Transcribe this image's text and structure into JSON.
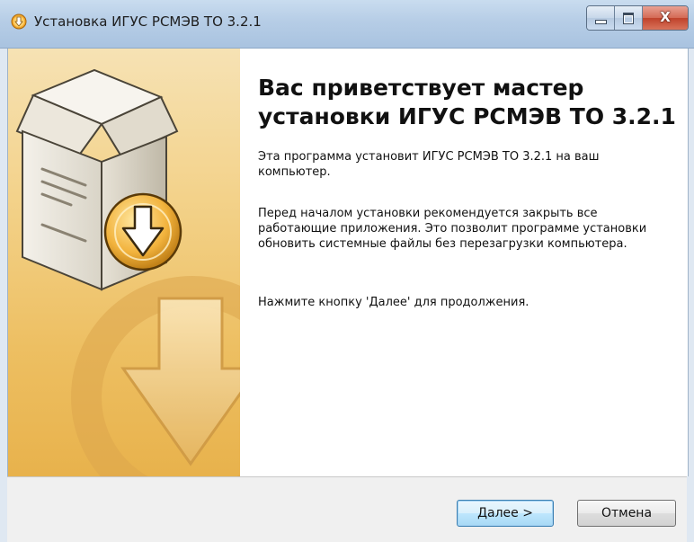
{
  "window": {
    "title": "Установка ИГУС РСМЭВ ТО 3.2.1",
    "controls": [
      "minimize-icon",
      "maximize-icon",
      "close-icon"
    ],
    "close_glyph": "X"
  },
  "wizard": {
    "heading": "Вас приветствует мастер установки ИГУС РСМЭВ ТО 3.2.1",
    "paragraphs": [
      "Эта программа установит ИГУС РСМЭВ ТО 3.2.1 на ваш компьютер.",
      "Перед началом установки рекомендуется закрыть все работающие приложения. Это позволит программе установки обновить системные файлы без перезагрузки компьютера.",
      "Нажмите кнопку 'Далее' для продолжения."
    ],
    "side_image": "installer-box-with-download-arrow"
  },
  "buttons": {
    "next_label": "Далее >",
    "cancel_label": "Отмена"
  },
  "colors": {
    "side_panel": "#f0c66a",
    "accent_button": "#bee6fd",
    "titlebar": "#b6cde6"
  }
}
